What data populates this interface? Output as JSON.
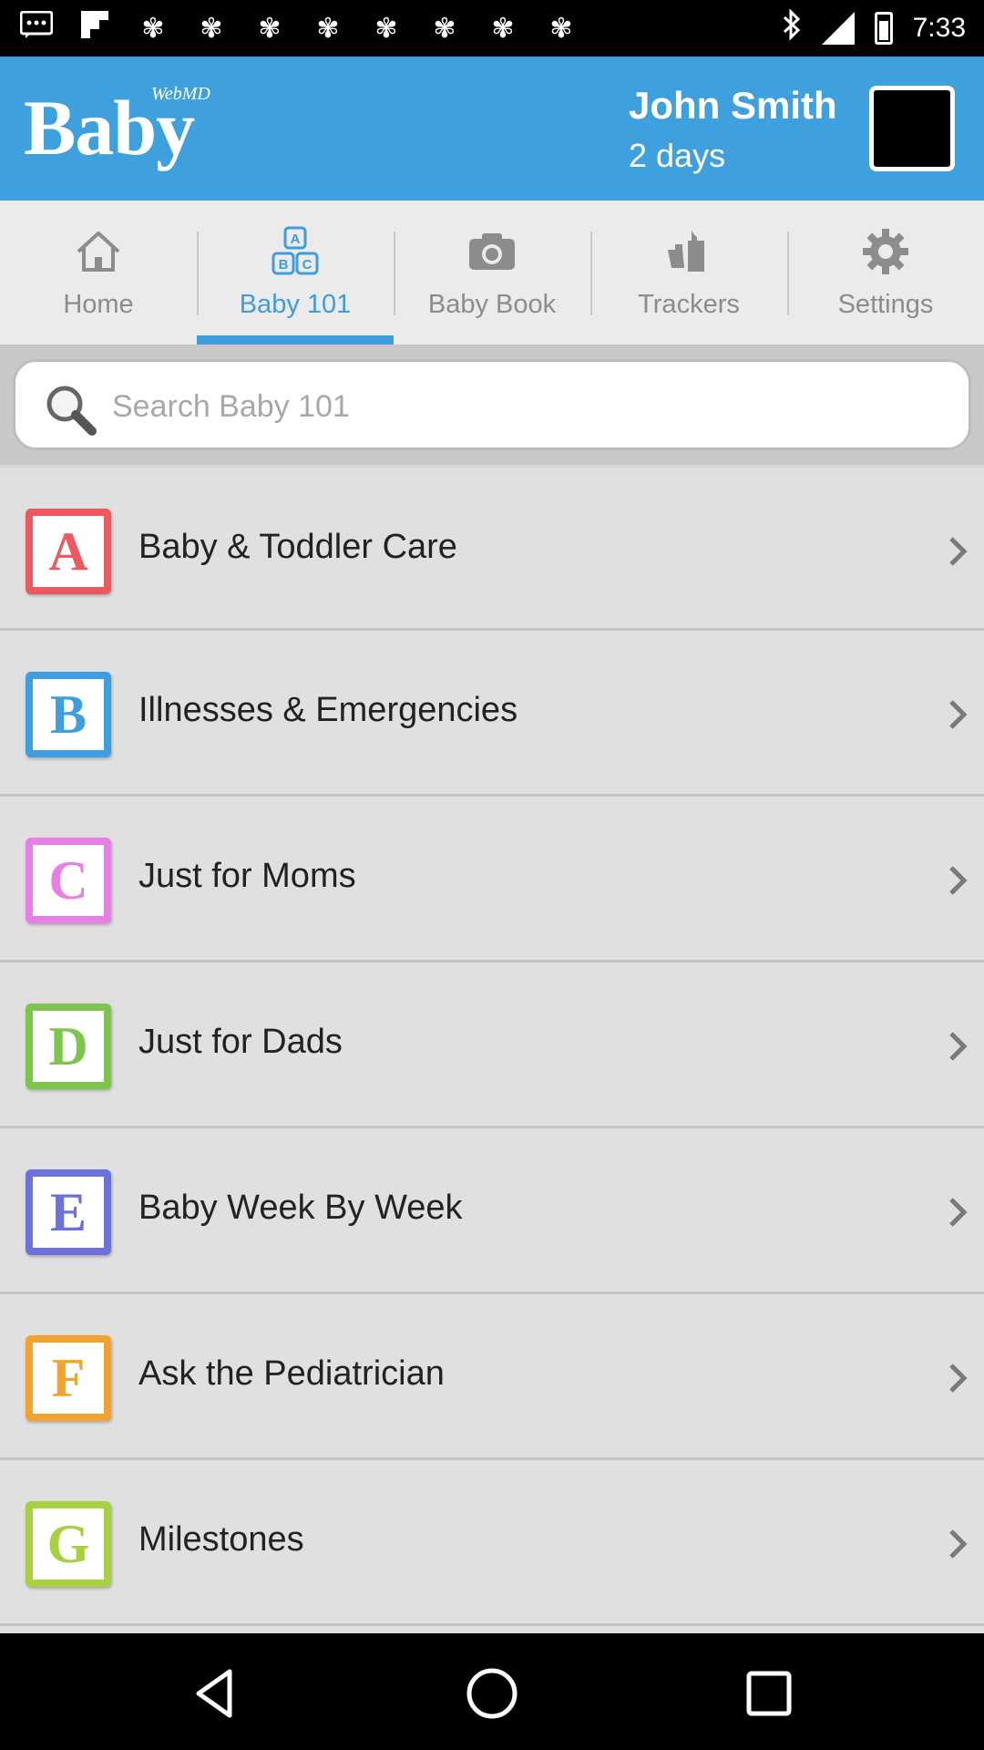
{
  "status_bar": {
    "time": "7:33",
    "notification_icons": [
      "message-icon",
      "flipboard-icon",
      "ribbon-icon",
      "ribbon-icon",
      "ribbon-icon",
      "ribbon-icon",
      "ribbon-icon",
      "ribbon-icon",
      "ribbon-icon",
      "ribbon-icon",
      "ribbon-icon",
      "ribbon-icon"
    ],
    "system_icons": [
      "bluetooth-icon",
      "signal-icon",
      "battery-icon"
    ]
  },
  "header": {
    "logo_small": "WebMD",
    "logo_big": "Baby",
    "user_name": "John Smith",
    "user_days": "2 days",
    "accent": "#3fa0de"
  },
  "tabs": [
    {
      "label": "Home",
      "icon": "home-icon",
      "active": false
    },
    {
      "label": "Baby 101",
      "icon": "abc-blocks-icon",
      "active": true
    },
    {
      "label": "Baby Book",
      "icon": "camera-icon",
      "active": false
    },
    {
      "label": "Trackers",
      "icon": "bottle-icon",
      "active": false
    },
    {
      "label": "Settings",
      "icon": "gear-icon",
      "active": false
    }
  ],
  "search": {
    "placeholder": "Search Baby 101"
  },
  "list": [
    {
      "letter": "A",
      "label": "Baby & Toddler Care",
      "color": "#ec5a5f"
    },
    {
      "letter": "B",
      "label": "Illnesses & Emergencies",
      "color": "#3d9ee0"
    },
    {
      "letter": "C",
      "label": "Just for Moms",
      "color": "#e97fe6"
    },
    {
      "letter": "D",
      "label": "Just for Dads",
      "color": "#7cc64b"
    },
    {
      "letter": "E",
      "label": "Baby Week By Week",
      "color": "#6b72de"
    },
    {
      "letter": "F",
      "label": "Ask the Pediatrician",
      "color": "#f2a22d"
    },
    {
      "letter": "G",
      "label": "Milestones",
      "color": "#a6d23f"
    }
  ],
  "nav_bar": [
    "back-icon",
    "home-circle-icon",
    "recents-icon"
  ]
}
